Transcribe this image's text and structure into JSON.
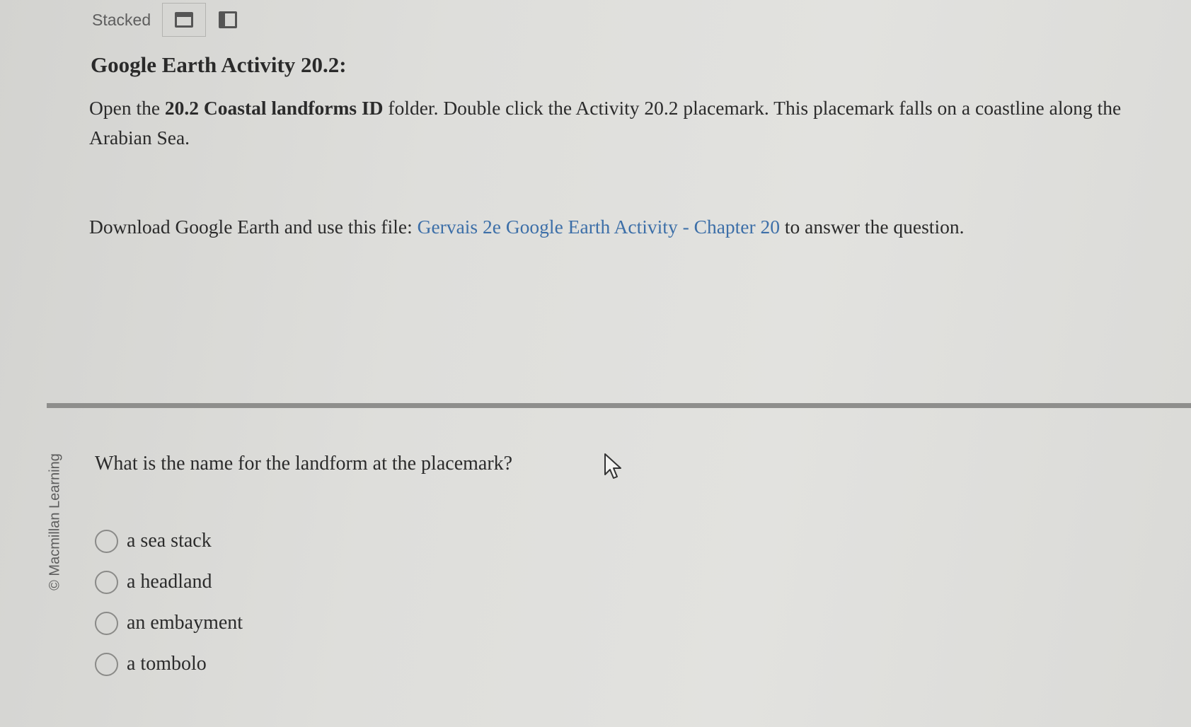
{
  "toolbar": {
    "label": "Stacked",
    "stacked_icon": "stacked-view-icon",
    "split_icon": "split-view-icon"
  },
  "activity": {
    "title": "Google Earth Activity 20.2:",
    "instruction": {
      "open_text": "Open the ",
      "folder_name": "20.2 Coastal landforms ID",
      "rest_text": " folder. Double click the Activity 20.2 placemark. This placemark falls on a coastline along the Arabian Sea."
    },
    "download": {
      "prefix": "Download Google Earth and use this file: ",
      "link_text": "Gervais 2e Google Earth Activity - Chapter 20",
      "suffix": " to answer the question."
    }
  },
  "sidebar": {
    "copyright": "© Macmillan Learning"
  },
  "question": {
    "prompt": "What is the name for the landform at the placemark?",
    "options": [
      {
        "label": "a sea stack"
      },
      {
        "label": "a headland"
      },
      {
        "label": "an embayment"
      },
      {
        "label": "a tombolo"
      }
    ]
  },
  "colors": {
    "link": "#3d6fa8",
    "divider": "#8e8e8c"
  }
}
